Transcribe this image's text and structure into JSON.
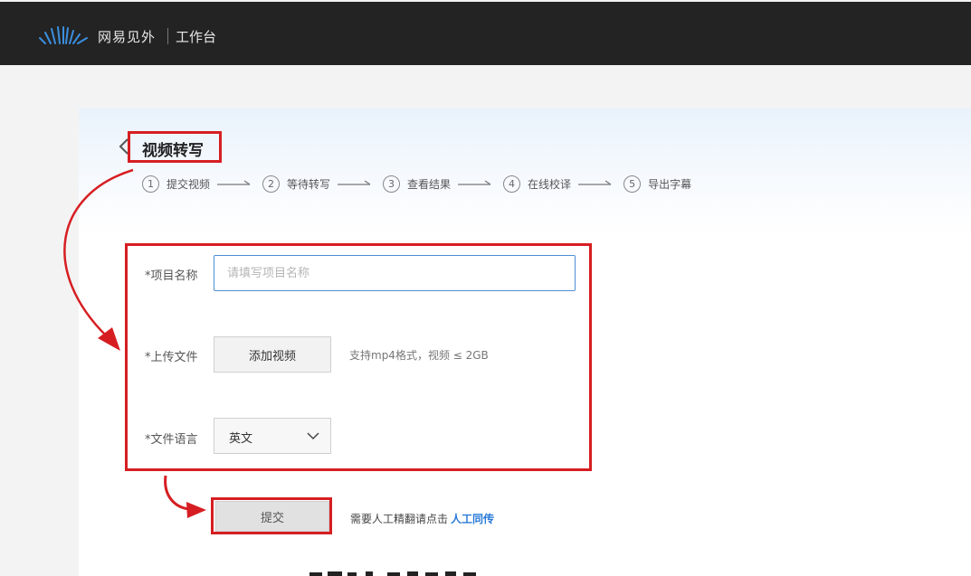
{
  "header": {
    "brand": "网易见外",
    "workbench": "工作台"
  },
  "page": {
    "title": "视频转写"
  },
  "steps": [
    {
      "num": "1",
      "label": "提交视频"
    },
    {
      "num": "2",
      "label": "等待转写"
    },
    {
      "num": "3",
      "label": "查看结果"
    },
    {
      "num": "4",
      "label": "在线校译"
    },
    {
      "num": "5",
      "label": "导出字幕"
    }
  ],
  "form": {
    "project_name_label": "*项目名称",
    "project_name_placeholder": "请填写项目名称",
    "upload_label": "*上传文件",
    "upload_button": "添加视频",
    "upload_hint": "支持mp4格式，视频 ≤ 2GB",
    "language_label": "*文件语言",
    "language_value": "英文"
  },
  "actions": {
    "submit": "提交",
    "manual_hint": "需要人工精翻请点击",
    "manual_link": "人工同传"
  },
  "colors": {
    "header_bg": "#232323",
    "annotation_red": "#d61e22",
    "link_blue": "#2a7ad8",
    "input_focus": "#4d8fd6"
  }
}
